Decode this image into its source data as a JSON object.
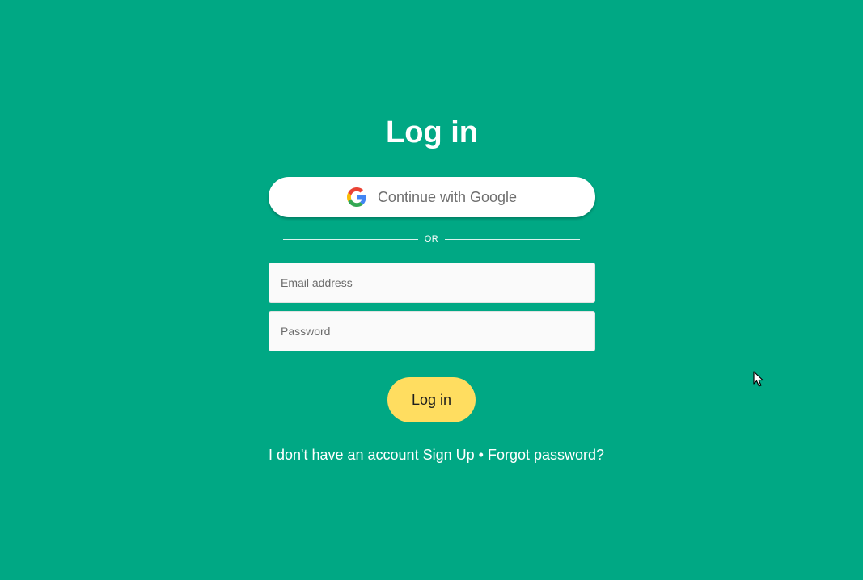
{
  "page": {
    "title": "Log in"
  },
  "google_button": {
    "label": "Continue with Google",
    "icon": "google-g-icon"
  },
  "divider": {
    "text": "OR"
  },
  "form": {
    "email_placeholder": "Email address",
    "password_placeholder": "Password",
    "submit_label": "Log in"
  },
  "footer": {
    "no_account_text": "I don't have an account",
    "signup_link": "Sign Up",
    "separator": "•",
    "forgot_password_link": "Forgot password?"
  },
  "colors": {
    "background": "#00a884",
    "primary_button": "#ffdd60",
    "google_button": "#ffffff",
    "input_background": "#fafafa"
  }
}
